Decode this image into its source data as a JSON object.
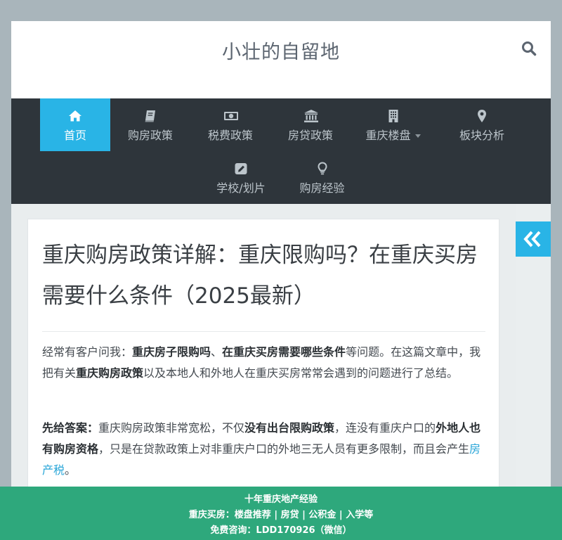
{
  "site": {
    "title": "小壮的自留地"
  },
  "nav": {
    "items": [
      {
        "label": "首页",
        "icon": "home-icon",
        "active": true
      },
      {
        "label": "购房政策",
        "icon": "book-icon"
      },
      {
        "label": "税费政策",
        "icon": "money-icon"
      },
      {
        "label": "房贷政策",
        "icon": "bank-icon"
      },
      {
        "label": "重庆楼盘",
        "icon": "building-icon",
        "has_dropdown": true
      },
      {
        "label": "板块分析",
        "icon": "map-marker-icon"
      },
      {
        "label": "学校/划片",
        "icon": "edit-icon"
      },
      {
        "label": "购房经验",
        "icon": "lightbulb-icon"
      }
    ]
  },
  "article": {
    "title": "重庆购房政策详解：重庆限购吗？在重庆买房需要什么条件（2025最新）",
    "p1": {
      "t1": "经常有客户问我：",
      "b1": "重庆房子限购吗",
      "t2": "、",
      "b2": "在重庆买房需要哪些条件",
      "t3": "等问题。在这篇文章中，我把有关",
      "b3": "重庆购房政策",
      "t4": "以及本地人和外地人在重庆买房常常会遇到的问题进行了总结。"
    },
    "p2": {
      "b1": "先给答案：",
      "t1": "重庆购房政策非常宽松，不仅",
      "b2": "没有出台限购政策",
      "t2": "，连没有重庆户口的",
      "b3": "外地人也有购房资格",
      "t3": "，只是在贷款政策上对非重庆户口的外地三无人员有更多限制，而且会产生",
      "link": "房产税",
      "t4": "。"
    }
  },
  "footer": {
    "line1": "十年重庆地产经验",
    "line2": "重庆买房：楼盘推荐 | 房贷 | 公积金 | 入学等",
    "line3": "免费咨询：LDD170926（微信）"
  },
  "colors": {
    "accent": "#29b4e6",
    "nav_bg": "#2e353b",
    "footer_bg": "#2ea87c",
    "page_bg": "#a9b5bb"
  }
}
